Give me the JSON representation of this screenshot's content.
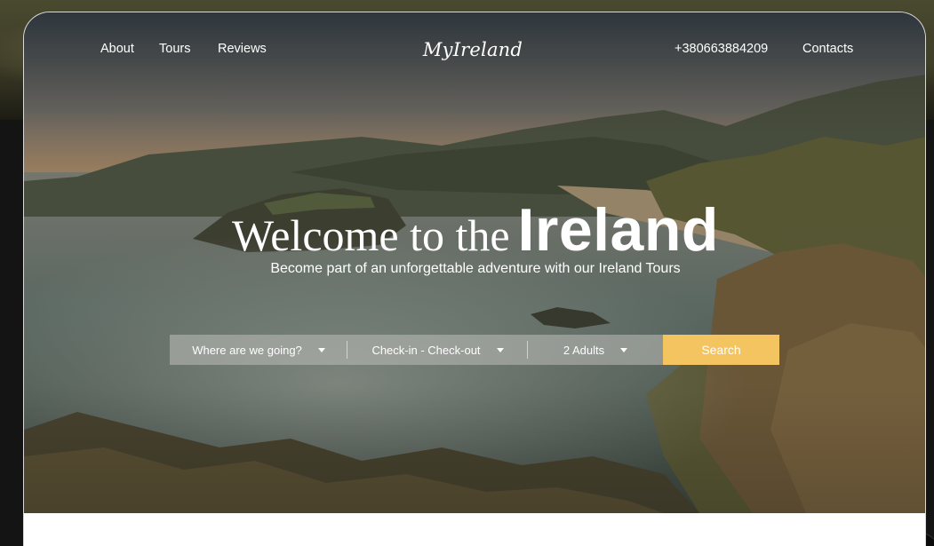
{
  "nav": {
    "links": [
      "About",
      "Tours",
      "Reviews"
    ],
    "logo": "MyIreland",
    "phone": "+380663884209",
    "contacts": "Contacts"
  },
  "hero": {
    "headline_light": "Welcome to the",
    "headline_bold": "Ireland",
    "subtitle": "Become part of an unforgettable adventure with our Ireland Tours"
  },
  "search": {
    "destination": "Where are we going?",
    "dates": "Check-in - Check-out",
    "guests": "2 Adults",
    "button": "Search"
  },
  "colors": {
    "accent": "#f4c460",
    "text": "#ffffff"
  },
  "icons": {
    "dropdown": "chevron-down-icon"
  }
}
